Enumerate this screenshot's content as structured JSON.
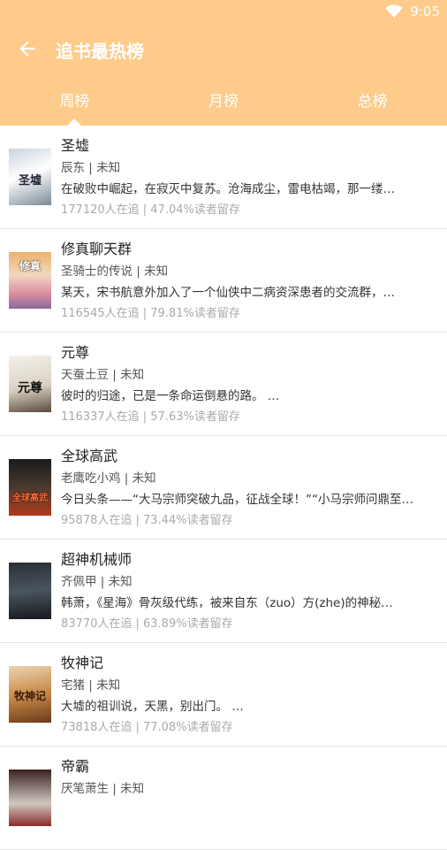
{
  "status": {
    "time": "9:05"
  },
  "header": {
    "title": "追书最热榜"
  },
  "tabs": [
    {
      "label": "周榜",
      "active": true
    },
    {
      "label": "月榜",
      "active": false
    },
    {
      "label": "总榜",
      "active": false
    }
  ],
  "colors": {
    "header_bg": "#fecb8b"
  },
  "books": [
    {
      "title": "圣墟",
      "author": "辰东 | 未知",
      "desc": "在破败中崛起，在寂灭中复苏。沧海成尘，雷电枯竭，那一缕…",
      "stats": "177120人在追 | 47.04%读者留存",
      "cover_text": "圣墟"
    },
    {
      "title": "修真聊天群",
      "author": "圣骑士的传说 | 未知",
      "desc": "某天，宋书航意外加入了一个仙侠中二病资深患者的交流群，…",
      "stats": "116545人在追 | 79.81%读者留存",
      "cover_text": "修真"
    },
    {
      "title": "元尊",
      "author": "天蚕土豆 | 未知",
      "desc": "彼时的归途，已是一条命运倒悬的路。 …",
      "stats": "116337人在追 | 57.63%读者留存",
      "cover_text": "元尊"
    },
    {
      "title": "全球高武",
      "author": "老鹰吃小鸡 | 未知",
      "desc": "今日头条——“大马宗师突破九品，征战全球！”“小马宗师问鼎至…",
      "stats": "95878人在追 | 73.44%读者留存",
      "cover_text": "全球高武"
    },
    {
      "title": "超神机械师",
      "author": "齐佩甲 | 未知",
      "desc": "韩萧，《星海》骨灰级代练，被来自东（zuo）方(zhe)的神秘…",
      "stats": "83770人在追 | 63.89%读者留存",
      "cover_text": ""
    },
    {
      "title": "牧神记",
      "author": "宅猪 | 未知",
      "desc": "大墟的祖训说，天黑，别出门。 …",
      "stats": "73818人在追 | 77.08%读者留存",
      "cover_text": "牧神记"
    },
    {
      "title": "帝霸",
      "author": "厌笔萧生 | 未知",
      "desc": "",
      "stats": "",
      "cover_text": ""
    }
  ]
}
